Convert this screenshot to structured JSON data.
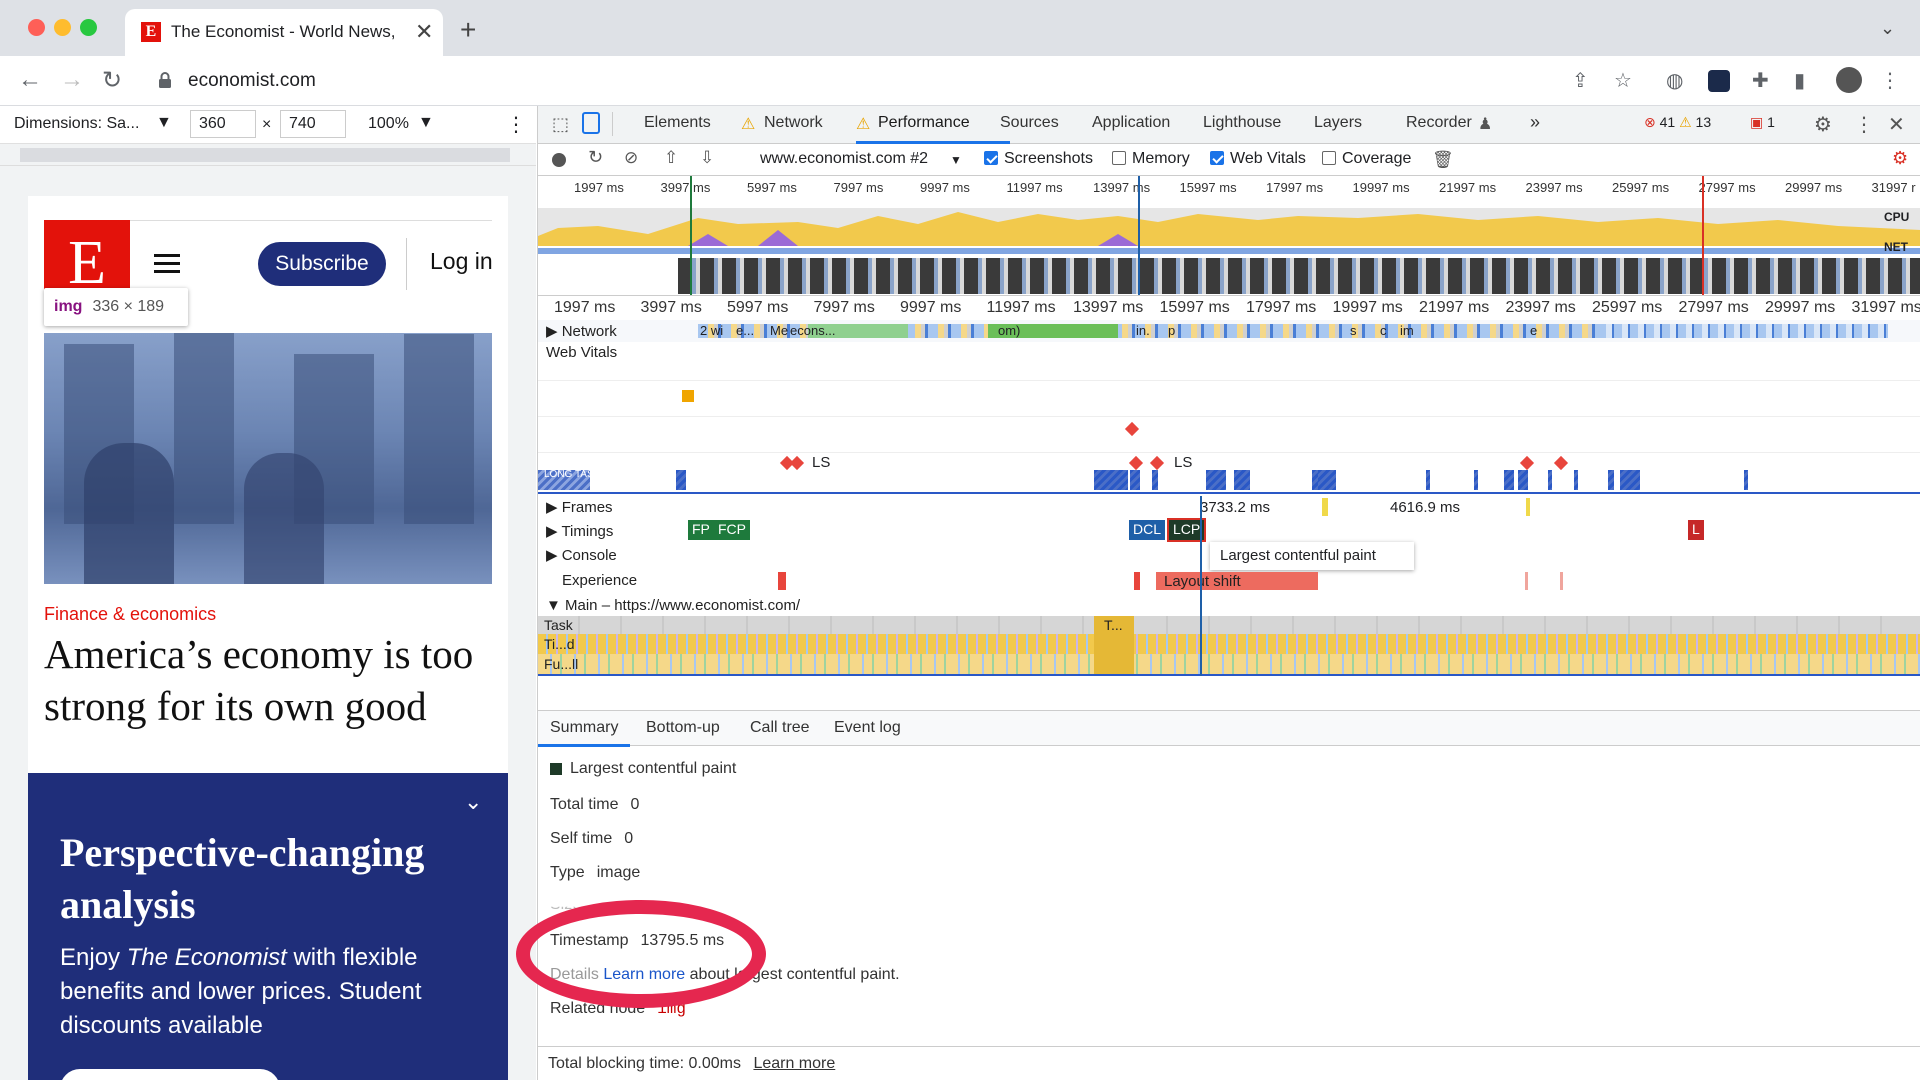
{
  "browser": {
    "tab_title": "The Economist - World News, P",
    "url": "economist.com"
  },
  "device_toolbar": {
    "dimensions_label": "Dimensions: Sa...",
    "width": "360",
    "times": "×",
    "height": "740",
    "zoom": "100%"
  },
  "page": {
    "logo_letter": "E",
    "subscribe_label": "Subscribe",
    "login_label": "Log in",
    "tooltip_tag": "img",
    "tooltip_size": "336 × 189",
    "kicker": "Finance & economics",
    "headline": "America’s economy is too strong for its own good",
    "promo_heading": "Perspective-changing analysis",
    "promo_text_pre": "Enjoy ",
    "promo_text_em": "The Economist",
    "promo_text_post": " with flexible benefits and lower prices. Student discounts available"
  },
  "devtools": {
    "tabs": [
      "Elements",
      "Network",
      "Performance",
      "Sources",
      "Application",
      "Lighthouse",
      "Layers",
      "Recorder"
    ],
    "more": "»",
    "errors": "41",
    "warnings": "13",
    "issues": "1",
    "recording_name": "www.economist.com #2",
    "options": {
      "screenshots": "Screenshots",
      "memory": "Memory",
      "web_vitals": "Web Vitals",
      "coverage": "Coverage"
    },
    "overview_ticks": [
      "1997 ms",
      "3997 ms",
      "5997 ms",
      "7997 ms",
      "9997 ms",
      "11997 ms",
      "13997 ms",
      "15997 ms",
      "17997 ms",
      "19997 ms",
      "21997 ms",
      "23997 ms",
      "25997 ms",
      "27997 ms",
      "29997 ms",
      "31997 r"
    ],
    "cpu_label": "CPU",
    "net_label": "NET",
    "ruler_ticks": [
      "1997 ms",
      "3997 ms",
      "5997 ms",
      "7997 ms",
      "9997 ms",
      "11997 ms",
      "13997 ms",
      "15997 ms",
      "17997 ms",
      "19997 ms",
      "21997 ms",
      "23997 ms",
      "25997 ms",
      "27997 ms",
      "29997 ms",
      "31997 ms"
    ],
    "tracks": {
      "network": "Network",
      "network_snippets": [
        "2 wi",
        "e...",
        "Me",
        "econs...",
        "om)",
        "in.",
        "p",
        "s",
        "c",
        "im",
        "e"
      ],
      "web_vitals": "Web Vitals",
      "ls": "LS",
      "long_tasks": "LONG TASKS",
      "frames": "Frames",
      "frame_a": "3733.2 ms",
      "frame_b": "4616.9 ms",
      "timings": "Timings",
      "fp": "FP",
      "fcp": "FCP",
      "dcl": "DCL",
      "lcp": "LCP",
      "l": "L",
      "lcp_tooltip": "Largest contentful paint",
      "console": "Console",
      "experience": "Experience",
      "layout_shift": "Layout shift",
      "main": "Main – https://www.economist.com/",
      "task": "Task",
      "task_t": "T...",
      "tid": "Ti...d",
      "full": "Fu...ll"
    },
    "bottom_tabs": [
      "Summary",
      "Bottom-up",
      "Call tree",
      "Event log"
    ],
    "summary": {
      "title": "Largest contentful paint",
      "total_time_label": "Total time",
      "total_time": "0",
      "self_time_label": "Self time",
      "self_time": "0",
      "type_label": "Type",
      "type": "image",
      "partial_hidden": "Size 52166",
      "timestamp_label": "Timestamp",
      "timestamp": "13795.5 ms",
      "details_label": "Details",
      "learn_more": "Learn more",
      "details_tail": "about largest contentful paint.",
      "related_node_label": "Related node",
      "related_node": "img"
    },
    "status": {
      "text": "Total blocking time: 0.00ms",
      "link": "Learn more"
    }
  },
  "colors": {
    "economist_red": "#e3120b",
    "economist_navy": "#1f2e7a",
    "annotation": "#e5274f",
    "long_task": "#2a58c6"
  }
}
